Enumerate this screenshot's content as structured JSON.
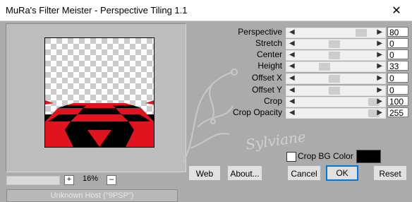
{
  "window": {
    "title": "MuRa's Filter Meister - Perspective Tiling 1.1",
    "close_glyph": "✕"
  },
  "zoom": {
    "plus": "+",
    "minus": "–",
    "value": "16%"
  },
  "status_text": "Unknown Host (\"9PSP\")",
  "watermark": "Sylviane",
  "controls": [
    {
      "label": "Perspective",
      "value": "80"
    },
    {
      "label": "Stretch",
      "value": "0"
    },
    {
      "label": "Center",
      "value": "0"
    },
    {
      "label": "Height",
      "value": "33"
    },
    {
      "label": "Offset X",
      "value": "0"
    },
    {
      "label": "Offset Y",
      "value": "0"
    },
    {
      "label": "Crop",
      "value": "100"
    },
    {
      "label": "Crop Opacity",
      "value": "255"
    }
  ],
  "crop_bg": {
    "label": "Crop BG Color",
    "checked": false,
    "color": "#000000"
  },
  "buttons": {
    "web": "Web",
    "about": "About...",
    "cancel": "Cancel",
    "ok": "OK",
    "reset": "Reset"
  },
  "colors": {
    "tile_red": "#e0141e",
    "tile_black": "#000000",
    "window_bg": "#ababab"
  }
}
